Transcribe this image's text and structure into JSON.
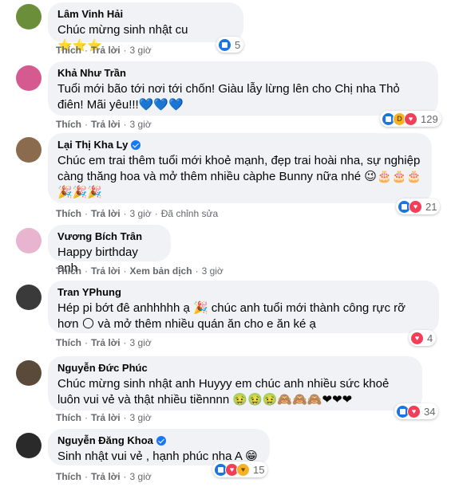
{
  "comments": [
    {
      "name": "Lâm Vinh Hải",
      "verified": false,
      "text": "Chúc mừng sinh nhật cu ⭐⭐⭐",
      "actions": {
        "like": "Thích",
        "reply": "Trả lời",
        "time": "3 giờ"
      },
      "reactions": {
        "icons": [
          "like"
        ],
        "count": "5"
      },
      "avatar_color": "#6b8e3a"
    },
    {
      "name": "Khả Như Trần",
      "verified": false,
      "text": "Tuổi mới bão tới nơi tới chốn! Giàu lẫy lừng lên cho Chị nha Thỏ điên! Mãi yêu!!!💙💙💙",
      "actions": {
        "like": "Thích",
        "reply": "Trả lời",
        "time": "3 giờ"
      },
      "reactions": {
        "icons": [
          "like",
          "haha",
          "love"
        ],
        "count": "129"
      },
      "avatar_color": "#d45a8f"
    },
    {
      "name": "Lại Thị Kha Ly",
      "verified": true,
      "text": "Chúc em trai thêm tuổi mới khoẻ mạnh, đẹp trai hoài nha, sự nghiệp càng thăng hoa và mở thêm nhiều càphe Bunny nữa nhé 😉🎂🎂🎂 🎉🎉🎉",
      "actions": {
        "like": "Thích",
        "reply": "Trả lời",
        "time": "3 giờ",
        "edited": "Đã chỉnh sửa"
      },
      "reactions": {
        "icons": [
          "like",
          "love"
        ],
        "count": "21"
      },
      "avatar_color": "#8a6b4e"
    },
    {
      "name": "Vương Bích Trân",
      "verified": false,
      "text": "Happy birthday anh",
      "actions": {
        "like": "Thích",
        "reply": "Trả lời",
        "translate": "Xem bản dịch",
        "time": "3 giờ"
      },
      "reactions": null,
      "avatar_color": "#e8b4d0"
    },
    {
      "name": "Tran YPhung",
      "verified": false,
      "text": "Hép pi bớt đê anhhhhh ạ 🎉 chúc anh tuổi mới thành công rực rỡ hơn 🌕 và mở thêm nhiều quán ăn cho e ăn ké ạ",
      "actions": {
        "like": "Thích",
        "reply": "Trả lời",
        "time": "3 giờ"
      },
      "reactions": {
        "icons": [
          "love"
        ],
        "count": "4"
      },
      "avatar_color": "#3a3a3a"
    },
    {
      "name": "Nguyễn Đức Phúc",
      "verified": false,
      "text": "Chúc mừng sinh nhật anh Huyyy em chúc anh nhiều sức khoẻ luôn vui vẻ và thật nhiều tiềnnnn 🤢🤢🤢🙈🙈🙈❤❤❤",
      "actions": {
        "like": "Thích",
        "reply": "Trả lời",
        "time": "3 giờ"
      },
      "reactions": {
        "icons": [
          "like",
          "love"
        ],
        "count": "34"
      },
      "avatar_color": "#5a4a3a"
    },
    {
      "name": "Nguyễn Đăng Khoa",
      "verified": true,
      "text": "Sinh nhật vui vẻ , hạnh phúc nha A 😁",
      "actions": {
        "like": "Thích",
        "reply": "Trả lời",
        "time": "3 giờ"
      },
      "reactions": {
        "icons": [
          "like",
          "love",
          "care"
        ],
        "count": "15"
      },
      "avatar_color": "#2a2a2a"
    }
  ]
}
